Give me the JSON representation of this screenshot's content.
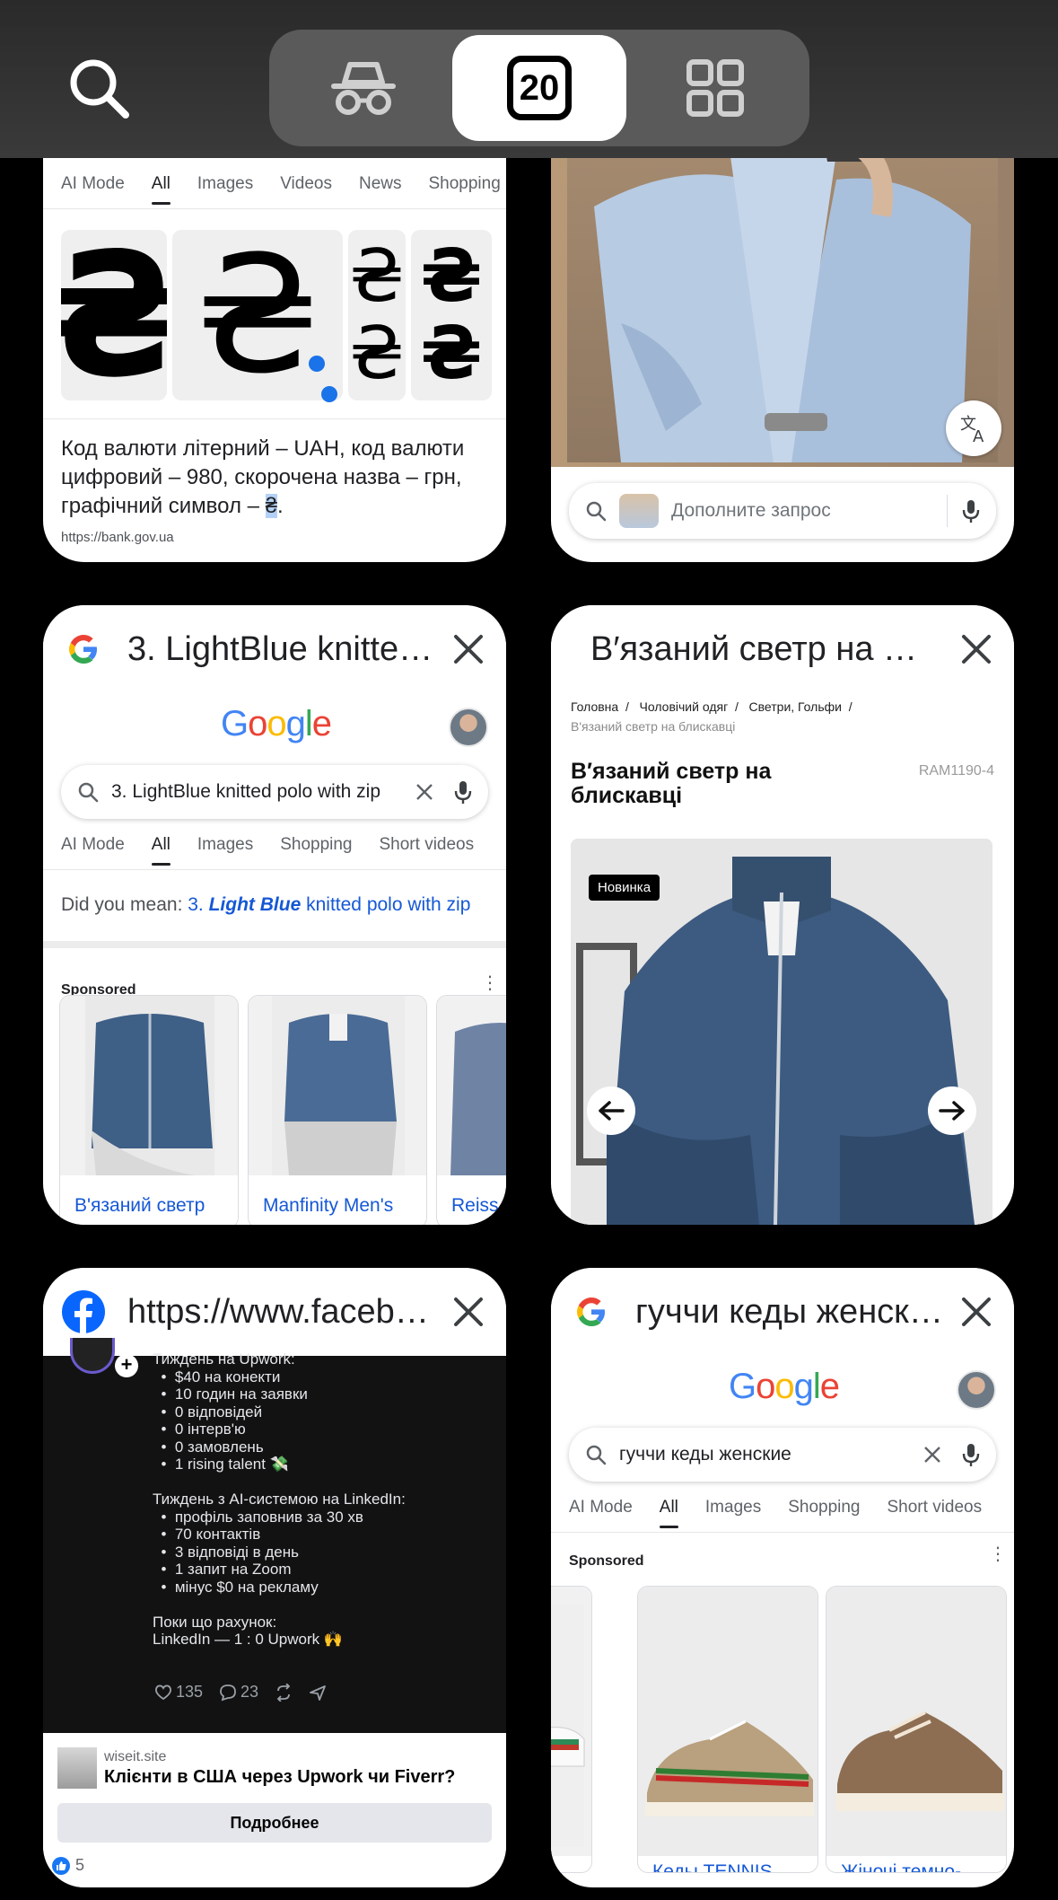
{
  "switcher": {
    "tab_count": "20",
    "colors": {
      "bar": "#333333",
      "segment": "#5a5a5a",
      "selected": "#ffffff"
    }
  },
  "cards": {
    "hryvnia": {
      "tabs": [
        "AI Mode",
        "All",
        "Images",
        "Videos",
        "News",
        "Shopping"
      ],
      "symbols": [
        "₴",
        "₴",
        "₴₴",
        "₴₴"
      ],
      "snippet_before": "Код валюти літерний – UAH, код валюти цифровий – 980, скорочена назва – грн, графічний символ – ",
      "snippet_selected": "₴",
      "snippet_after": ".",
      "source": "https://bank.gov.ua"
    },
    "shirt": {
      "lens_placeholder": "Дополните запрос"
    },
    "lightblue": {
      "title": "3. LightBlue knitted polo with zip",
      "logo": "Google",
      "query": "3. LightBlue knitted polo with zip",
      "tabs": [
        "AI Mode",
        "All",
        "Images",
        "Shopping",
        "Short videos"
      ],
      "did_you_mean_label": "Did you mean:",
      "did_you_mean_prefix": "3.",
      "did_you_mean_bold": "Light Blue",
      "did_you_mean_rest": "knitted polo with zip",
      "sponsored": "Sponsored",
      "products": [
        "В'язаний светр",
        "Manfinity Men's",
        "Reiss"
      ]
    },
    "sweater": {
      "title": "В′язаний светр на блискавці",
      "breadcrumbs": [
        "Головна",
        "Чоловічий одяг",
        "Светри, Гольфи"
      ],
      "breadcrumb_current": "В'язаний светр на блискавці",
      "product_title": "В′язаний светр на блискавці",
      "sku": "RAM1190-4",
      "badge": "Новинка"
    },
    "facebook": {
      "title": "https://www.facebook.com",
      "post_text": "Тиждень на Upwork:\n  •  $40 на конекти\n  •  10 годин на заявки\n  •  0 відповідей\n  •  0 інтерв'ю\n  •  0 замовлень\n  •  1 rising talent 💸\n\nТиждень з AI-системою на LinkedIn:\n  •  профіль заповнив за 30 хв\n  •  70 контактів\n  •  3 відповіді в день\n  •  1 запит на Zoom\n  •  мінус $0 на рекламу\n\nПоки що рахунок:\nLinkedIn — 1 : 0 Upwork 🙌",
      "likes": "135",
      "comments": "23",
      "ad_site": "wiseit.site",
      "ad_title": "Клієнти в США через Upwork чи Fiverr?",
      "ad_button": "Подробнее",
      "reactions": "5"
    },
    "gucci": {
      "title": "гуччи кеды женские",
      "logo": "Google",
      "query": "гуччи кеды женские",
      "tabs": [
        "AI Mode",
        "All",
        "Images",
        "Shopping",
        "Short videos"
      ],
      "sponsored": "Sponsored",
      "products": [
        "",
        "Кеды TENNIS",
        "Жіночі темно-"
      ]
    }
  }
}
